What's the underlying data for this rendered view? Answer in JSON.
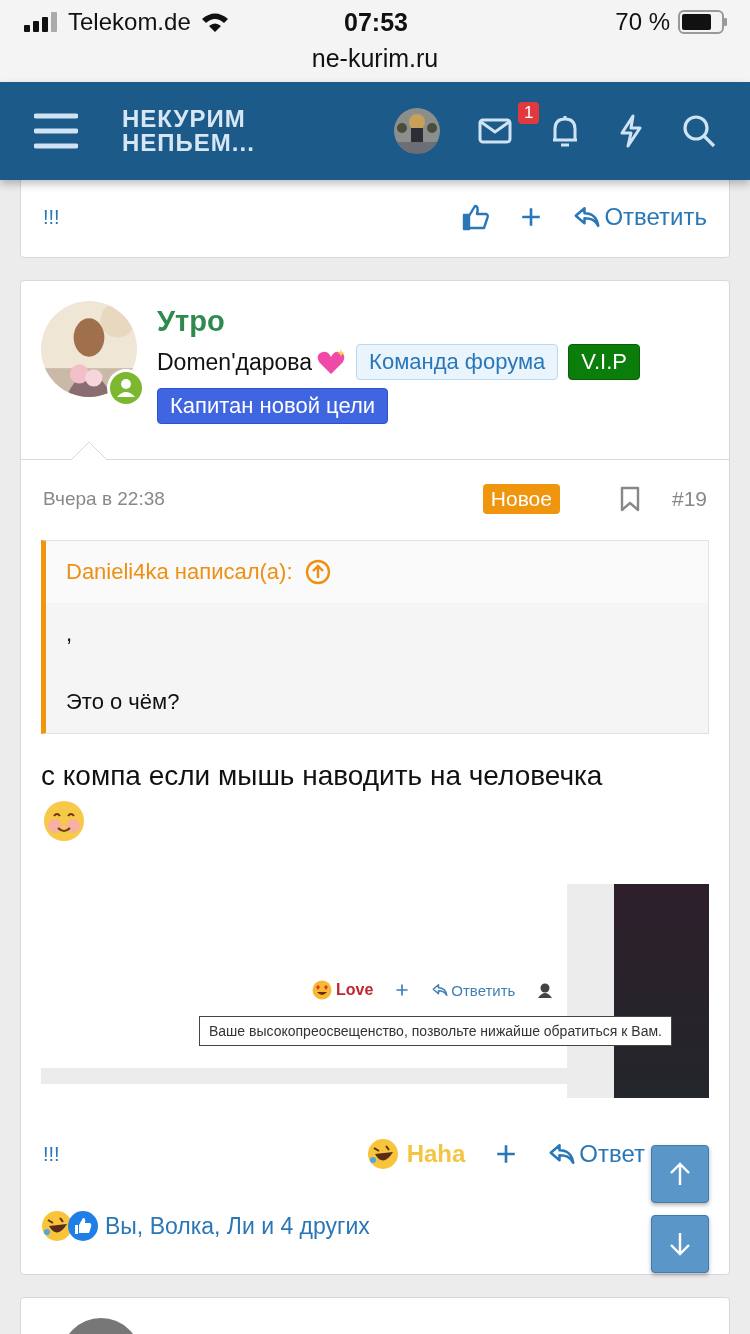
{
  "status_bar": {
    "carrier": "Telekom.de",
    "time": "07:53",
    "battery": "70 %"
  },
  "address_bar": {
    "url": "ne-kurim.ru"
  },
  "header": {
    "logo_lines": [
      "НЕКУРИМ",
      "НЕПЬЕМ..."
    ],
    "notification_count": "1"
  },
  "previous_post": {
    "signature": "!!!",
    "reply": "Ответить"
  },
  "post": {
    "author": "Утро",
    "user_title": "Domen'дарова",
    "banners": [
      {
        "label": "Команда форума",
        "kind": "outline"
      },
      {
        "label": "V.I.P",
        "kind": "green"
      },
      {
        "label": "Капитан новой цели",
        "kind": "blue"
      }
    ],
    "date": "Вчера в 22:38",
    "badge": "Новое",
    "number": "#19",
    "quote": {
      "author": "Danieli4ka написал(а):",
      "lines": [
        ",",
        "Это о чём?"
      ]
    },
    "body": "с компа если мышь наводить на человечка",
    "embedded_screenshot": {
      "reaction": "Love",
      "reply": "Ответить",
      "tooltip": "Ваше высокопреосвещенство, позвольте нижайше обратиться к Вам."
    },
    "signature": "!!!",
    "reaction": "Haha",
    "reply": "Ответ",
    "reactions_summary": "Вы, Волка, Ли и 4 других"
  }
}
